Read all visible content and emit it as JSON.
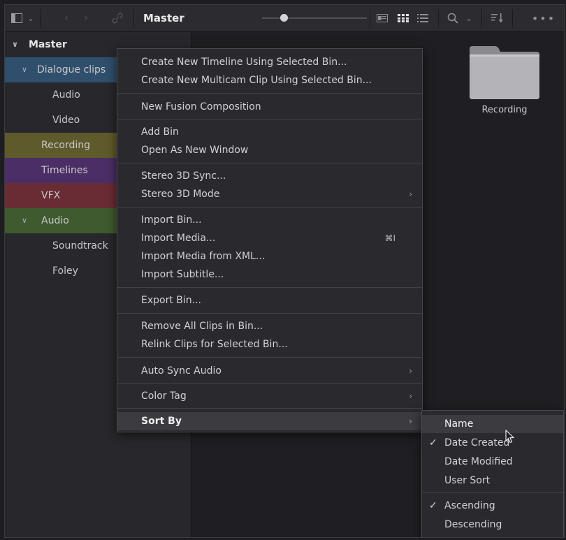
{
  "toolbar": {
    "title": "Master",
    "icons": [
      "sidebar-toggle-icon",
      "chevron-down-icon",
      "back-icon",
      "forward-icon",
      "link-icon",
      "view-metadata-icon",
      "view-thumbnail-icon",
      "view-list-icon",
      "search-icon",
      "chevron-down-icon",
      "sort-icon",
      "more-icon"
    ],
    "thumb_size_fraction": 0.17
  },
  "sidebar": {
    "master": "Master",
    "items": [
      {
        "label": "Dialogue clips",
        "color": "#2f4f6c",
        "expanded": true
      },
      {
        "label": "Audio",
        "color": ""
      },
      {
        "label": "Video",
        "color": ""
      },
      {
        "label": "Recording",
        "color": "#5f5a2b"
      },
      {
        "label": "Timelines",
        "color": "#4b2e66"
      },
      {
        "label": "VFX",
        "color": "#6a2c34"
      },
      {
        "label": "Audio",
        "color": "#3e5a2e",
        "expanded": true
      },
      {
        "label": "Soundtrack",
        "color": ""
      },
      {
        "label": "Foley",
        "color": ""
      }
    ]
  },
  "content": {
    "folder_label": "Recording"
  },
  "menu": {
    "items": [
      {
        "label": "Create New Timeline Using Selected Bin..."
      },
      {
        "label": "Create New Multicam Clip Using Selected Bin..."
      },
      {
        "label": "New Fusion Composition"
      },
      {
        "label": "Add Bin"
      },
      {
        "label": "Open As New Window"
      },
      {
        "label": "Stereo 3D Sync..."
      },
      {
        "label": "Stereo 3D Mode",
        "submenu": true
      },
      {
        "label": "Import Bin..."
      },
      {
        "label": "Import Media...",
        "shortcut": "⌘I"
      },
      {
        "label": "Import Media from XML..."
      },
      {
        "label": "Import Subtitle..."
      },
      {
        "label": "Export Bin..."
      },
      {
        "label": "Remove All Clips in Bin..."
      },
      {
        "label": "Relink Clips for Selected Bin..."
      },
      {
        "label": "Auto Sync Audio",
        "submenu": true
      },
      {
        "label": "Color Tag",
        "submenu": true
      },
      {
        "label": "Sort By",
        "submenu": true,
        "highlighted": true
      }
    ],
    "arrow": "›"
  },
  "submenu": {
    "items": [
      {
        "label": "Name",
        "highlighted": true
      },
      {
        "label": "Date Created",
        "checked": true
      },
      {
        "label": "Date Modified"
      },
      {
        "label": "User Sort"
      },
      {
        "label": "Ascending",
        "checked": true
      },
      {
        "label": "Descending"
      }
    ],
    "check": "✓"
  }
}
